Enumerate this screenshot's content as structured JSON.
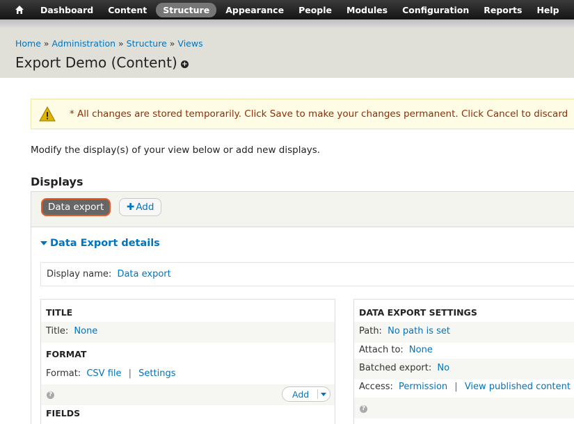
{
  "toolbar": {
    "home_icon": "home-icon",
    "items": [
      "Dashboard",
      "Content",
      "Structure",
      "Appearance",
      "People",
      "Modules",
      "Configuration",
      "Reports",
      "Help"
    ],
    "active": "Structure"
  },
  "breadcrumb": {
    "items": [
      "Home",
      "Administration",
      "Structure",
      "Views"
    ],
    "separator": "»"
  },
  "page_title": "Export Demo (Content)",
  "shortcut_icon": "add-shortcut-icon",
  "warning": {
    "icon": "warning-icon",
    "message": "* All changes are stored temporarily. Click Save to make your changes permanent. Click Cancel to discard"
  },
  "intro": "Modify the display(s) of your view below or add new displays.",
  "displays": {
    "heading": "Displays",
    "tabs": [
      "Data export"
    ],
    "add_label": "Add",
    "add_icon": "plus-icon"
  },
  "details": {
    "toggle_label": "Data Export details",
    "display_name_label": "Display name:",
    "display_name_value": "Data export"
  },
  "left": {
    "title_heading": "TITLE",
    "title_label": "Title:",
    "title_value": "None",
    "format_heading": "FORMAT",
    "format_label": "Format:",
    "format_value": "CSV file",
    "format_sep": "|",
    "format_settings": "Settings",
    "fields_add": "Add",
    "fields_heading": "FIELDS"
  },
  "right": {
    "heading": "DATA EXPORT SETTINGS",
    "path_label": "Path:",
    "path_value": "No path is set",
    "attach_label": "Attach to:",
    "attach_value": "None",
    "batched_label": "Batched export:",
    "batched_value": "No",
    "access_label": "Access:",
    "access_value": "Permission",
    "access_sep": "|",
    "access_value2": "View published content"
  },
  "colors": {
    "link": "#0074bd",
    "warning_text": "#8c2e0b",
    "active_tab_border": "#e85a26"
  }
}
